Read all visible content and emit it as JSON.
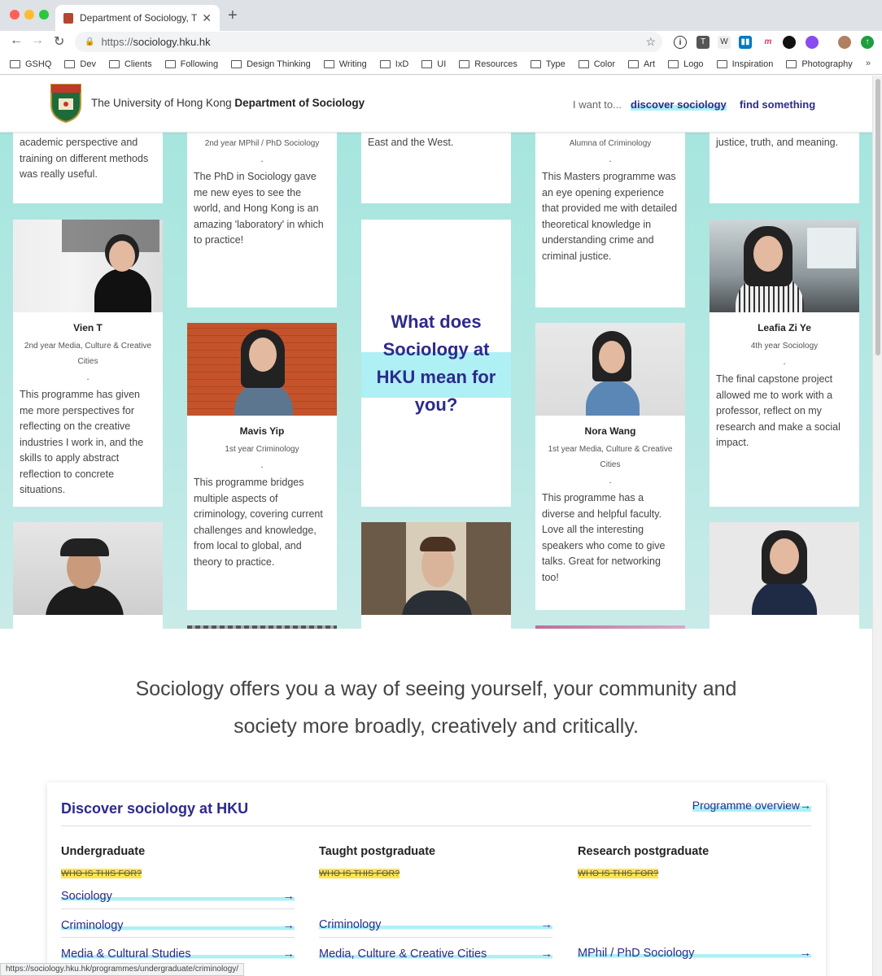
{
  "browser": {
    "tab_title": "Department of Sociology, The",
    "new_tab": "+",
    "url_scheme": "https://",
    "url_host": "sociology.hku.hk",
    "bookmarks": [
      "GSHQ",
      "Dev",
      "Clients",
      "Following",
      "Design Thinking",
      "Writing",
      "IxD",
      "UI",
      "Resources",
      "Type",
      "Color",
      "Art",
      "Logo",
      "Inspiration",
      "Photography"
    ],
    "more": "»",
    "status_url": "https://sociology.hku.hk/programmes/undergraduate/criminology/"
  },
  "header": {
    "university": "The University of Hong Kong",
    "department": "Department of Sociology",
    "prompt": "I want to...",
    "link_discover": "discover sociology",
    "link_find": "find something"
  },
  "mosaic": {
    "question": [
      "What does",
      "Sociology at",
      "HKU mean for",
      "you?"
    ],
    "top_fragments": {
      "c1": "academic perspective and training on different methods was really useful.",
      "c2_role": "2nd year MPhil / PhD Sociology",
      "c2_quote": "The PhD in Sociology gave me new eyes to see the world, and Hong Kong is an amazing 'laboratory' in which to practice!",
      "c3": "East and the West.",
      "c4_role": "Alumna of Criminology",
      "c4_quote": "This Masters programme was an eye opening experience that provided me with detailed theoretical knowledge in understanding crime and criminal justice.",
      "c5": "justice, truth, and meaning."
    },
    "cards": [
      {
        "name": "Vien T",
        "role": "2nd year Media, Culture & Creative Cities",
        "quote": "This programme has given me more perspectives for reflecting on the creative industries I work in, and the skills to apply abstract reflection to concrete situations."
      },
      {
        "name": "Mavis Yip",
        "role": "1st year Criminology",
        "quote": "This programme bridges multiple aspects of criminology, covering current challenges and knowledge, from local to global, and theory to practice."
      },
      {
        "name": "Nora Wang",
        "role": "1st year Media, Culture & Creative Cities",
        "quote": "This programme has a diverse and helpful faculty. Love all the interesting speakers who come to give talks. Great for networking too!"
      },
      {
        "name": "Leafia Zi Ye",
        "role": "4th year Sociology",
        "quote": "The final capstone project allowed me to work with a professor, reflect on my research and make a social impact."
      }
    ],
    "dot": "."
  },
  "tagline": [
    "Sociology offers you a way of seeing yourself, your community and",
    "society more broadly, creatively and critically."
  ],
  "discover": {
    "title": "Discover sociology at HKU",
    "overview": "Programme overview",
    "arrow": "→",
    "who": "WHO IS THIS FOR?",
    "columns": [
      {
        "heading": "Undergraduate",
        "links": [
          "Sociology",
          "Criminology",
          "Media & Cultural Studies"
        ]
      },
      {
        "heading": "Taught postgraduate",
        "links": [
          "",
          "Criminology",
          "Media, Culture & Creative Cities"
        ]
      },
      {
        "heading": "Research postgraduate",
        "links": [
          "",
          "",
          "MPhil / PhD Sociology"
        ]
      }
    ]
  },
  "colors": {
    "accent": "#2d2a8c",
    "highlight": "#aef0f4",
    "mint": "#a6e6de",
    "who_highlight": "#ffe44d"
  }
}
